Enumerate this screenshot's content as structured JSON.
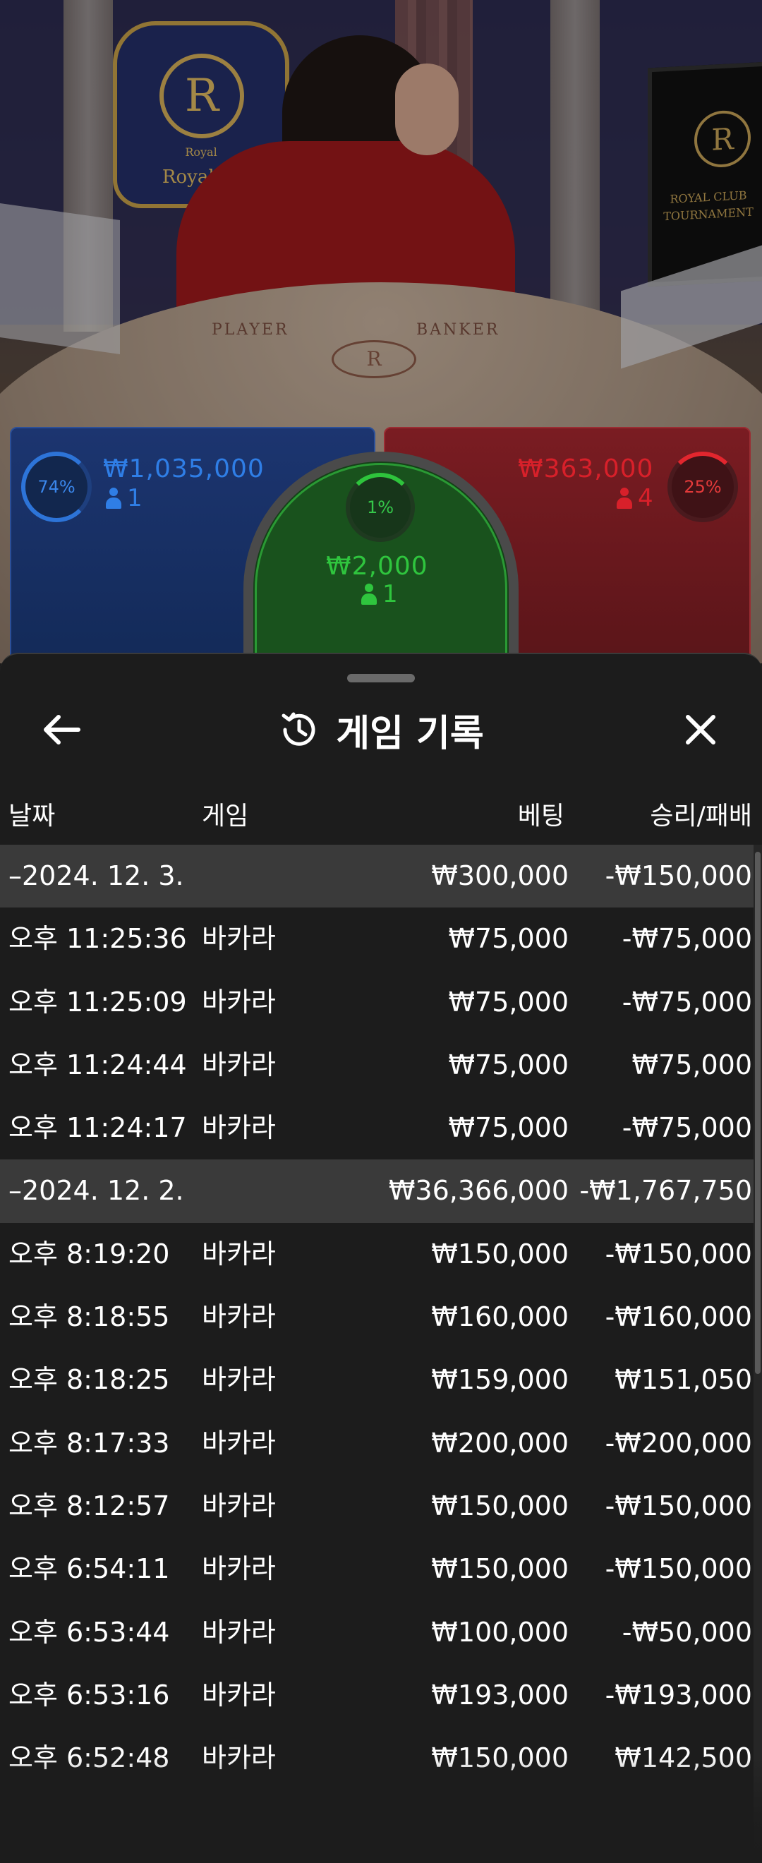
{
  "stage": {
    "logo_letter": "R",
    "logo_script": "Royal",
    "logo_text": "Royal.kr",
    "monitor_letter": "R",
    "monitor_title": "ROYAL CLUB",
    "monitor_sub": "TOURNAMENT",
    "table_player": "PLAYER",
    "table_banker": "BANKER",
    "table_seal": "R"
  },
  "bets": {
    "player": {
      "percent": "74%",
      "amount": "₩1,035,000",
      "count": "1",
      "color": "#2f7ee6"
    },
    "tie": {
      "percent": "1%",
      "amount": "₩2,000",
      "count": "1",
      "color": "#2fc53e"
    },
    "banker": {
      "percent": "25%",
      "amount": "₩363,000",
      "count": "4",
      "color": "#d8202a"
    }
  },
  "sheet": {
    "title": "게임 기록",
    "back_icon": "arrow-left-icon",
    "history_icon": "history-icon",
    "close_icon": "close-icon",
    "columns": {
      "date": "날짜",
      "game": "게임",
      "bet": "베팅",
      "result": "승리/패배"
    },
    "rows": [
      {
        "type": "group",
        "date": "–2024. 12. 3.",
        "bet": "₩300,000",
        "result": "-₩150,000"
      },
      {
        "type": "item",
        "date": "오후 11:25:36",
        "game": "바카라",
        "bet": "₩75,000",
        "result": "-₩75,000"
      },
      {
        "type": "item",
        "date": "오후 11:25:09",
        "game": "바카라",
        "bet": "₩75,000",
        "result": "-₩75,000"
      },
      {
        "type": "item",
        "date": "오후 11:24:44",
        "game": "바카라",
        "bet": "₩75,000",
        "result": "₩75,000"
      },
      {
        "type": "item",
        "date": "오후 11:24:17",
        "game": "바카라",
        "bet": "₩75,000",
        "result": "-₩75,000"
      },
      {
        "type": "group",
        "date": "–2024. 12. 2.",
        "bet": "₩36,366,000",
        "result": "-₩1,767,750"
      },
      {
        "type": "item",
        "date": "오후 8:19:20",
        "game": "바카라",
        "bet": "₩150,000",
        "result": "-₩150,000"
      },
      {
        "type": "item",
        "date": "오후 8:18:55",
        "game": "바카라",
        "bet": "₩160,000",
        "result": "-₩160,000"
      },
      {
        "type": "item",
        "date": "오후 8:18:25",
        "game": "바카라",
        "bet": "₩159,000",
        "result": "₩151,050"
      },
      {
        "type": "item",
        "date": "오후 8:17:33",
        "game": "바카라",
        "bet": "₩200,000",
        "result": "-₩200,000"
      },
      {
        "type": "item",
        "date": "오후 8:12:57",
        "game": "바카라",
        "bet": "₩150,000",
        "result": "-₩150,000"
      },
      {
        "type": "item",
        "date": "오후 6:54:11",
        "game": "바카라",
        "bet": "₩150,000",
        "result": "-₩150,000"
      },
      {
        "type": "item",
        "date": "오후 6:53:44",
        "game": "바카라",
        "bet": "₩100,000",
        "result": "-₩50,000"
      },
      {
        "type": "item",
        "date": "오후 6:53:16",
        "game": "바카라",
        "bet": "₩193,000",
        "result": "-₩193,000"
      },
      {
        "type": "item",
        "date": "오후 6:52:48",
        "game": "바카라",
        "bet": "₩150,000",
        "result": "₩142,500"
      }
    ]
  }
}
